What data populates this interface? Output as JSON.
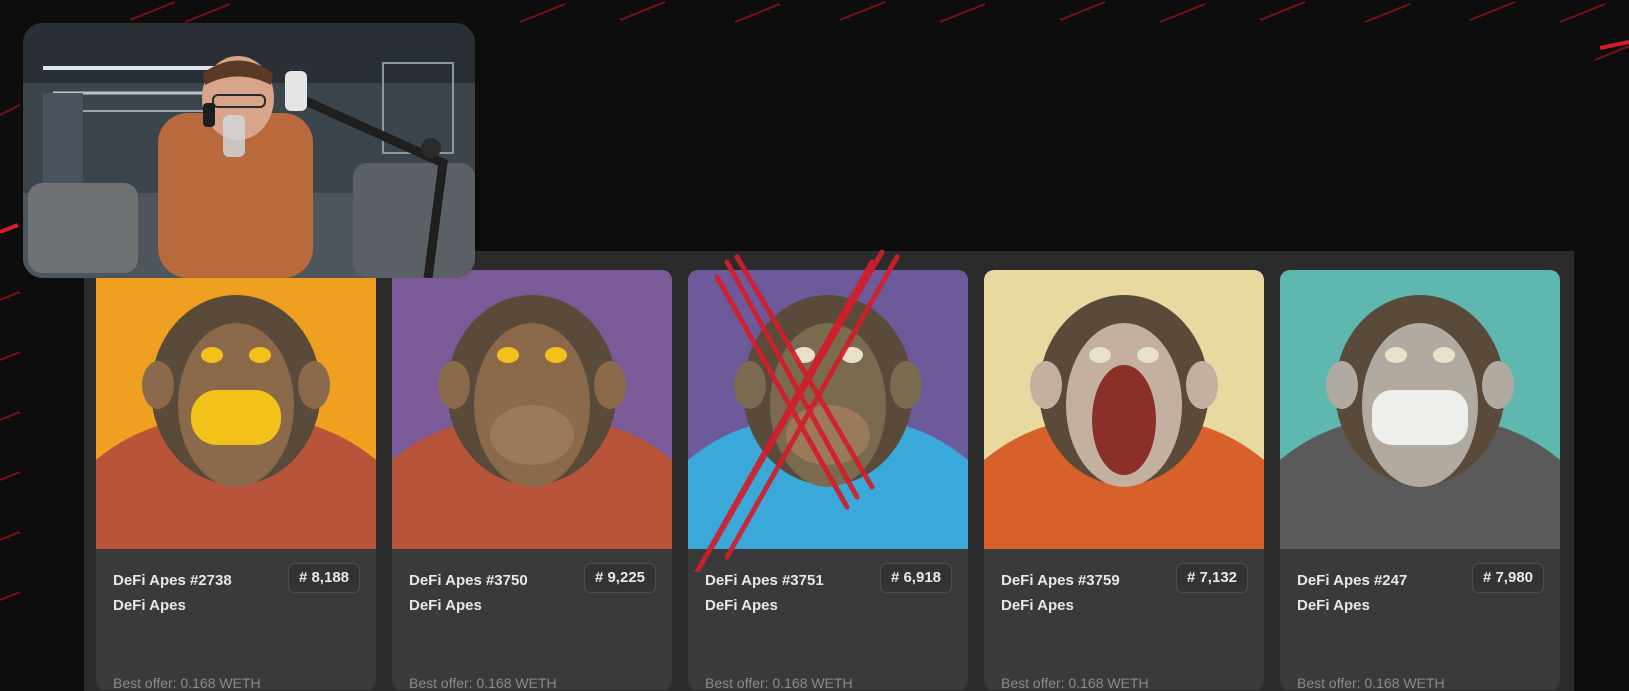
{
  "nfts": [
    {
      "name": "DeFi Apes #2738",
      "rank": "# 8,188",
      "collection": "DeFi Apes",
      "offer": "Best offer: 0.168 WETH",
      "bg": "#f0a020",
      "crossed": false
    },
    {
      "name": "DeFi Apes #3750",
      "rank": "# 9,225",
      "collection": "DeFi Apes",
      "offer": "Best offer: 0.168 WETH",
      "bg": "#7b5a98",
      "crossed": false
    },
    {
      "name": "DeFi Apes #3751",
      "rank": "# 6,918",
      "collection": "DeFi Apes",
      "offer": "Best offer: 0.168 WETH",
      "bg": "#6d5a9a",
      "crossed": true
    },
    {
      "name": "DeFi Apes #3759",
      "rank": "# 7,132",
      "collection": "DeFi Apes",
      "offer": "Best offer: 0.168 WETH",
      "bg": "#e8d9a0",
      "crossed": false
    },
    {
      "name": "DeFi Apes #247",
      "rank": "# 7,980",
      "collection": "DeFi Apes",
      "offer": "Best offer: 0.168 WETH",
      "bg": "#5fb8b0",
      "crossed": false
    }
  ],
  "colors": {
    "background": "#0d0d0d",
    "panel": "#2b2b2b",
    "card": "#3a3a3a",
    "accent_red": "#d21e2a"
  }
}
